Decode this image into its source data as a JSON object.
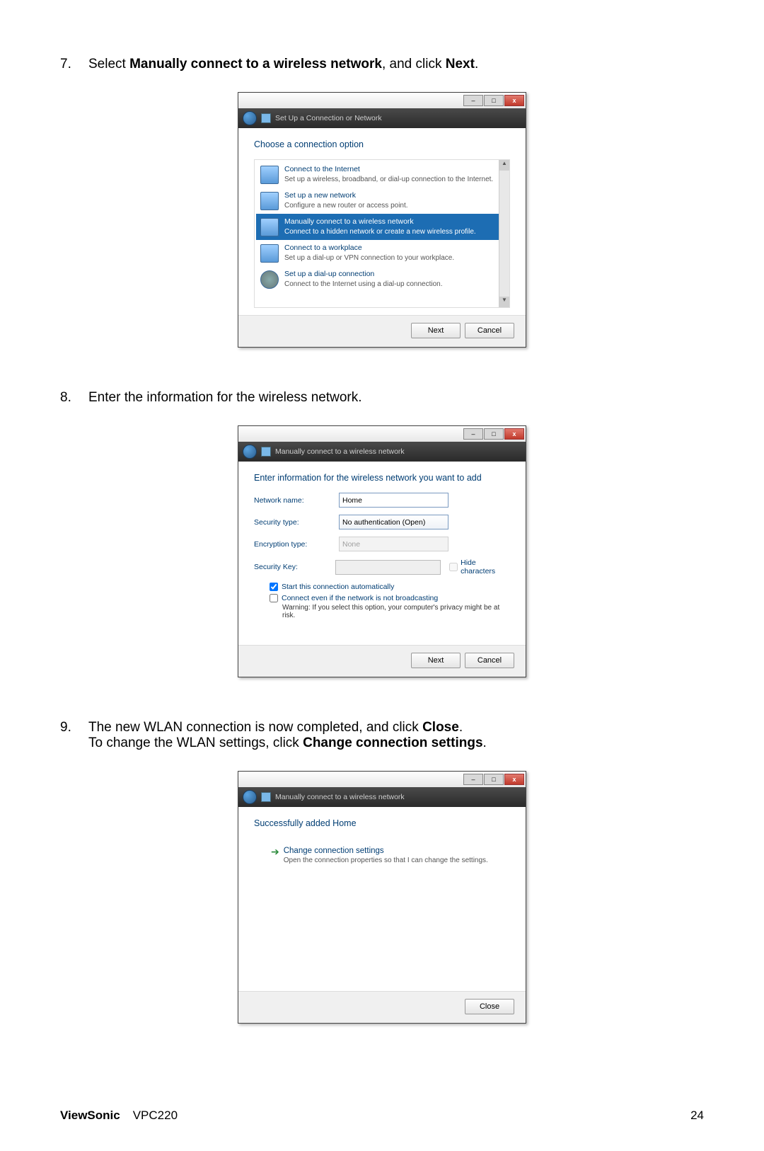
{
  "steps": {
    "s7": {
      "num": "7.",
      "pre": "Select ",
      "b1": "Manually connect to a wireless network",
      "mid": ", and click ",
      "b2": "Next",
      "post": "."
    },
    "s8": {
      "num": "8.",
      "text": "Enter the information for the wireless network."
    },
    "s9": {
      "num": "9.",
      "pre1": "The new WLAN connection is now completed, and click ",
      "b1": "Close",
      "post1": ".",
      "pre2": "To change the WLAN settings, click ",
      "b2": "Change connection settings",
      "post2": "."
    }
  },
  "dlg1": {
    "header": "Set Up a Connection or Network",
    "title": "Choose a connection option",
    "options": [
      {
        "title": "Connect to the Internet",
        "desc": "Set up a wireless, broadband, or dial-up connection to the Internet."
      },
      {
        "title": "Set up a new network",
        "desc": "Configure a new router or access point."
      },
      {
        "title": "Manually connect to a wireless network",
        "desc": "Connect to a hidden network or create a new wireless profile."
      },
      {
        "title": "Connect to a workplace",
        "desc": "Set up a dial-up or VPN connection to your workplace."
      },
      {
        "title": "Set up a dial-up connection",
        "desc": "Connect to the Internet using a dial-up connection."
      }
    ],
    "next": "Next",
    "cancel": "Cancel"
  },
  "dlg2": {
    "header": "Manually connect to a wireless network",
    "title": "Enter information for the wireless network you want to add",
    "fields": {
      "network_name_lbl": "Network name:",
      "network_name_val": "Home",
      "security_type_lbl": "Security type:",
      "security_type_val": "No authentication (Open)",
      "encryption_type_lbl": "Encryption type:",
      "encryption_type_val": "None",
      "security_key_lbl": "Security Key:",
      "security_key_val": "",
      "hide_chars": "Hide characters",
      "cb_start": "Start this connection automatically",
      "cb_connect": "Connect even if the network is not broadcasting",
      "warning": "Warning: If you select this option, your computer's privacy might be at risk."
    },
    "next": "Next",
    "cancel": "Cancel"
  },
  "dlg3": {
    "header": "Manually connect to a wireless network",
    "success": "Successfully added Home",
    "change_title": "Change connection settings",
    "change_desc": "Open the connection properties so that I can change the settings.",
    "close": "Close"
  },
  "footer": {
    "brand": "ViewSonic",
    "model": "VPC220",
    "page": "24"
  },
  "win": {
    "close_x": "x"
  }
}
